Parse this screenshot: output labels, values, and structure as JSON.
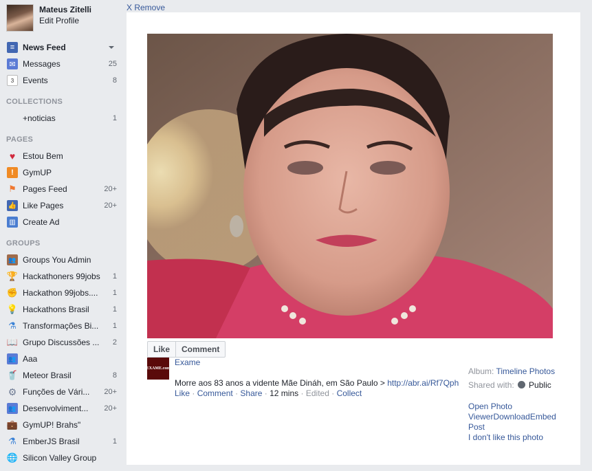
{
  "profile": {
    "name": "Mateus Zitelli",
    "edit": "Edit Profile"
  },
  "nav": [
    {
      "label": "News Feed",
      "count": "",
      "icon": "news-feed-icon",
      "bold": true
    },
    {
      "label": "Messages",
      "count": "25",
      "icon": "messages-icon"
    },
    {
      "label": "Events",
      "count": "8",
      "icon": "events-icon"
    }
  ],
  "collections": {
    "title": "COLLECTIONS",
    "items": [
      {
        "label": "+noticias",
        "count": "1"
      }
    ]
  },
  "pages": {
    "title": "PAGES",
    "items": [
      {
        "label": "Estou Bem",
        "count": "",
        "icon": "heart-icon"
      },
      {
        "label": "GymUP",
        "count": "",
        "icon": "gymup-icon"
      },
      {
        "label": "Pages Feed",
        "count": "20+",
        "icon": "flag-icon"
      },
      {
        "label": "Like Pages",
        "count": "20+",
        "icon": "thumbs-up-icon"
      },
      {
        "label": "Create Ad",
        "count": "",
        "icon": "bar-chart-icon"
      }
    ]
  },
  "groups": {
    "title": "GROUPS",
    "items": [
      {
        "label": "Groups You Admin",
        "count": "",
        "icon": "group-icon"
      },
      {
        "label": "Hackathoners 99jobs",
        "count": "1",
        "icon": "trophy-icon"
      },
      {
        "label": "Hackathon 99jobs....",
        "count": "1",
        "icon": "fist-icon"
      },
      {
        "label": "Hackathons Brasil",
        "count": "1",
        "icon": "lightbulb-icon"
      },
      {
        "label": "Transformações Bi...",
        "count": "1",
        "icon": "flask-icon"
      },
      {
        "label": "Grupo Discussões ...",
        "count": "2",
        "icon": "book-icon"
      },
      {
        "label": "Aaa",
        "count": "",
        "icon": "group-icon"
      },
      {
        "label": "Meteor Brasil",
        "count": "8",
        "icon": "cup-icon"
      },
      {
        "label": "Funções de Vári...",
        "count": "20+",
        "icon": "gear-icon"
      },
      {
        "label": "Desenvolviment...",
        "count": "20+",
        "icon": "group-icon"
      },
      {
        "label": "GymUP! Brahs\"",
        "count": "",
        "icon": "briefcase-icon"
      },
      {
        "label": "EmberJS Brasil",
        "count": "1",
        "icon": "flask-icon"
      },
      {
        "label": "Silicon Valley Group",
        "count": "",
        "icon": "globe-icon"
      }
    ]
  },
  "viewer": {
    "remove": "X Remove",
    "like": "Like",
    "comment": "Comment",
    "source_logo": "EXAME.com",
    "source": "Exame",
    "caption": "Morre aos 83 anos a vidente Mãe Dináh, em São Paulo > ",
    "caption_link": "http://abr.ai/Rf7Qph",
    "actions": {
      "like": "Like",
      "comment": "Comment",
      "share": "Share",
      "time": "12 mins",
      "edited": "Edited",
      "collect": "Collect"
    },
    "album_label": "Album:",
    "album_value": "Timeline Photos",
    "shared_label": "Shared with:",
    "shared_value": "Public",
    "options": [
      "Open Photo",
      "ViewerDownloadEmbed",
      "Post",
      "I don't like this photo"
    ]
  }
}
